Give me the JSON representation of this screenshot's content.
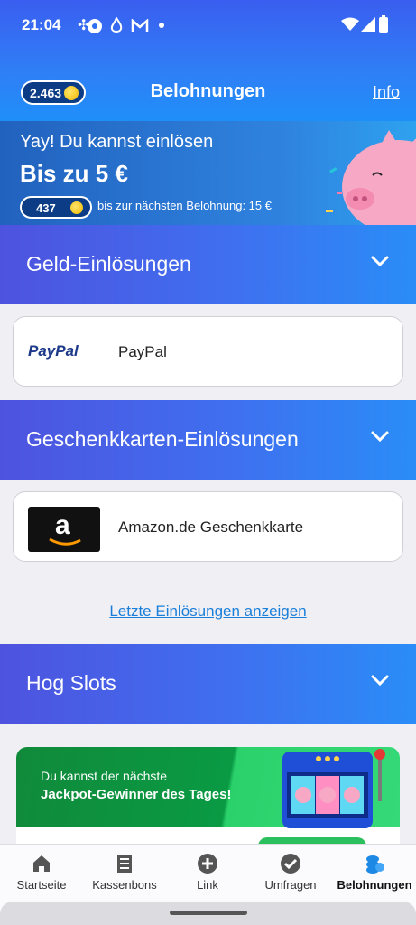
{
  "status_bar": {
    "time": "21:04",
    "icons": [
      "pinwheel-icon",
      "soccer-icon",
      "flame-icon",
      "m-logo-icon",
      "dot-icon"
    ],
    "right_icons": [
      "wifi-icon",
      "signal-icon",
      "battery-icon"
    ]
  },
  "header": {
    "balance": "2.463",
    "title": "Belohnungen",
    "info_label": "Info"
  },
  "banner": {
    "headline": "Yay! Du kannst einlösen",
    "amount": "Bis zu 5 €",
    "points": "437",
    "next_reward": "bis zur nächsten Belohnung: 15 €"
  },
  "sections": {
    "cash": {
      "title": "Geld-Einlösungen",
      "items": [
        {
          "logo_text": "PayPal",
          "label": "PayPal"
        }
      ]
    },
    "giftcards": {
      "title": "Geschenkkarten-Einlösungen",
      "items": [
        {
          "logo_text": "a",
          "label": "Amazon.de Geschenkkarte"
        }
      ]
    },
    "recent_link": "Letzte Einlösungen anzeigen",
    "slots": {
      "title": "Hog Slots",
      "promo_line1": "Du kannst der nächste",
      "promo_line2": "Jackpot-Gewinner des Tages!"
    }
  },
  "bottom_nav": [
    {
      "label": "Startseite",
      "icon": "home-icon",
      "active": false
    },
    {
      "label": "Kassenbons",
      "icon": "receipt-icon",
      "active": false
    },
    {
      "label": "Link",
      "icon": "plus-circle-icon",
      "active": false
    },
    {
      "label": "Umfragen",
      "icon": "check-circle-icon",
      "active": false
    },
    {
      "label": "Belohnungen",
      "icon": "coins-icon",
      "active": true
    }
  ],
  "colors": {
    "header_blue": "#2f7ff6",
    "section_gradient_start": "#4e53df",
    "section_gradient_end": "#2a8df7",
    "link_blue": "#1a7fd8",
    "coin_gold": "#f1b800",
    "promo_green": "#0a9a44"
  }
}
